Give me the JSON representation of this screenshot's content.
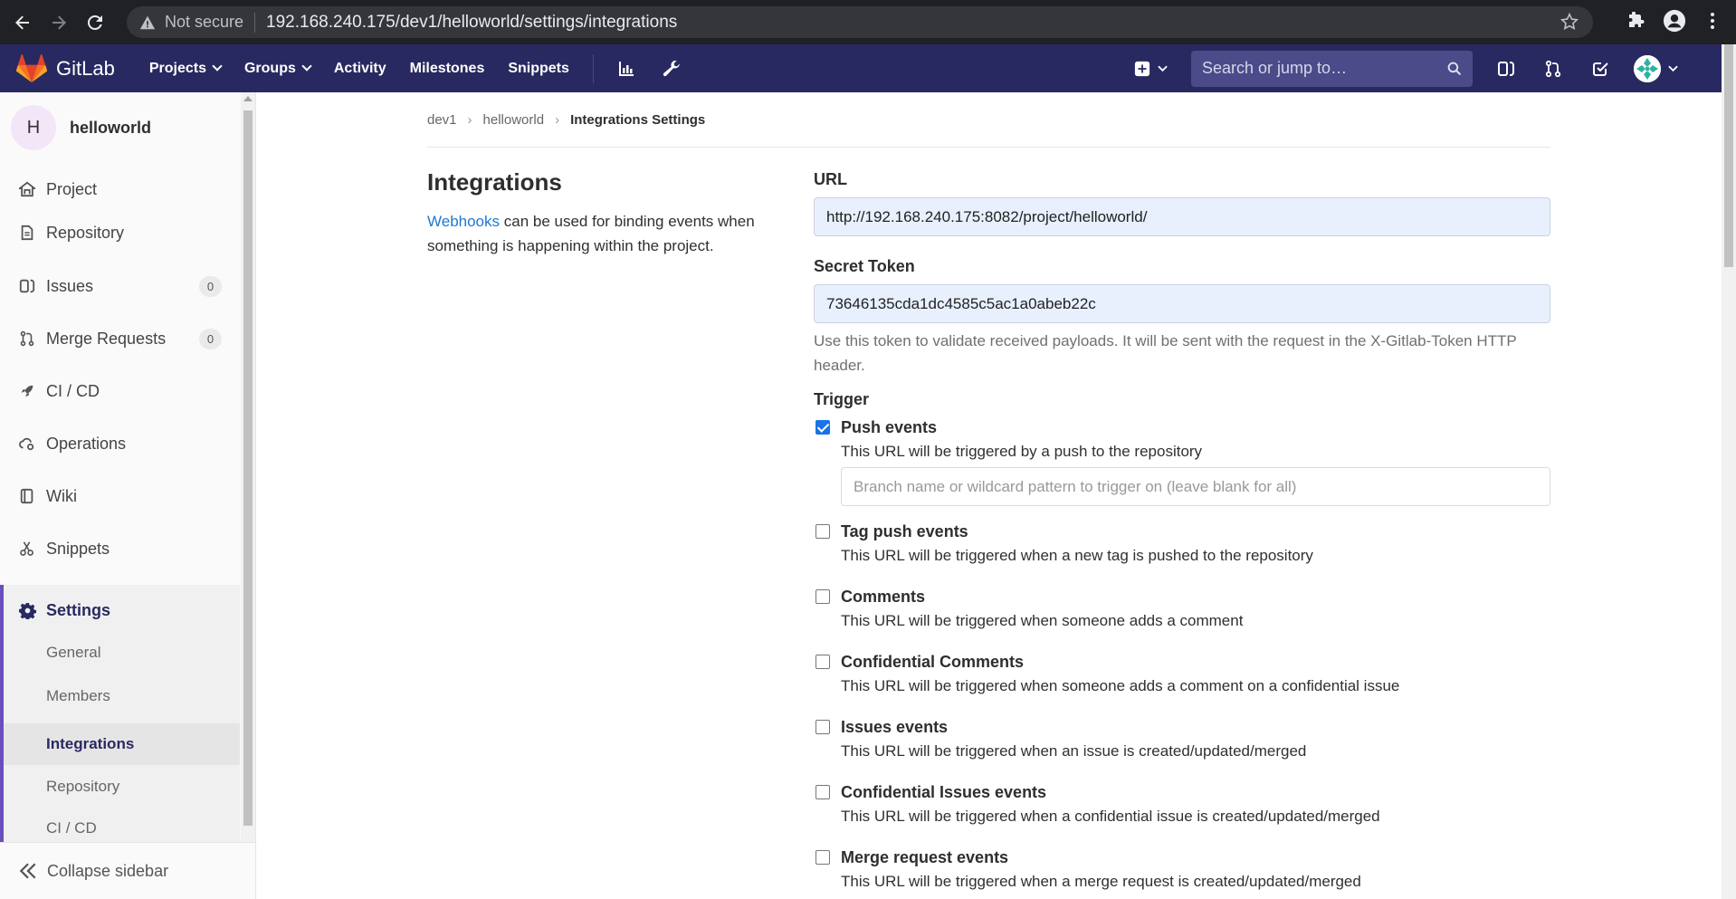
{
  "browser": {
    "security_label": "Not secure",
    "url": "192.168.240.175/dev1/helloworld/settings/integrations"
  },
  "navbar": {
    "brand": "GitLab",
    "links": [
      "Projects",
      "Groups",
      "Activity",
      "Milestones",
      "Snippets"
    ],
    "search_placeholder": "Search or jump to…"
  },
  "sidebar": {
    "project_initial": "H",
    "project_name": "helloworld",
    "items": [
      {
        "label": "Project",
        "icon": "home-icon"
      },
      {
        "label": "Repository",
        "icon": "doc-icon"
      },
      {
        "label": "Issues",
        "icon": "issues-icon",
        "badge": "0"
      },
      {
        "label": "Merge Requests",
        "icon": "merge-request-icon",
        "badge": "0"
      },
      {
        "label": "CI / CD",
        "icon": "rocket-icon"
      },
      {
        "label": "Operations",
        "icon": "cloud-gear-icon"
      },
      {
        "label": "Wiki",
        "icon": "book-icon"
      },
      {
        "label": "Snippets",
        "icon": "scissors-icon"
      },
      {
        "label": "Settings",
        "icon": "gear-icon"
      }
    ],
    "sub_items": [
      "General",
      "Members",
      "Integrations",
      "Repository",
      "CI / CD"
    ],
    "active_sub": "Integrations",
    "collapse_label": "Collapse sidebar"
  },
  "breadcrumb": [
    "dev1",
    "helloworld",
    "Integrations Settings"
  ],
  "intro": {
    "title": "Integrations",
    "link_text": "Webhooks",
    "text": " can be used for binding events when something is happening within the project."
  },
  "form": {
    "url_label": "URL",
    "url_value": "http://192.168.240.175:8082/project/helloworld/",
    "token_label": "Secret Token",
    "token_value": "73646135cda1dc4585c5ac1a0abeb22c",
    "token_hint": "Use this token to validate received payloads. It will be sent with the request in the X-Gitlab-Token HTTP header.",
    "trigger_label": "Trigger",
    "branch_placeholder": "Branch name or wildcard pattern to trigger on (leave blank for all)",
    "triggers": [
      {
        "name": "Push events",
        "desc": "This URL will be triggered by a push to the repository",
        "checked": true
      },
      {
        "name": "Tag push events",
        "desc": "This URL will be triggered when a new tag is pushed to the repository",
        "checked": false
      },
      {
        "name": "Comments",
        "desc": "This URL will be triggered when someone adds a comment",
        "checked": false
      },
      {
        "name": "Confidential Comments",
        "desc": "This URL will be triggered when someone adds a comment on a confidential issue",
        "checked": false
      },
      {
        "name": "Issues events",
        "desc": "This URL will be triggered when an issue is created/updated/merged",
        "checked": false
      },
      {
        "name": "Confidential Issues events",
        "desc": "This URL will be triggered when a confidential issue is created/updated/merged",
        "checked": false
      },
      {
        "name": "Merge request events",
        "desc": "This URL will be triggered when a merge request is created/updated/merged",
        "checked": false
      }
    ]
  },
  "colors": {
    "navbar": "#292961",
    "chrome": "#202124",
    "link": "#1f78d1",
    "active_accent": "#6b4fbb",
    "checkbox": "#1a73e8"
  }
}
